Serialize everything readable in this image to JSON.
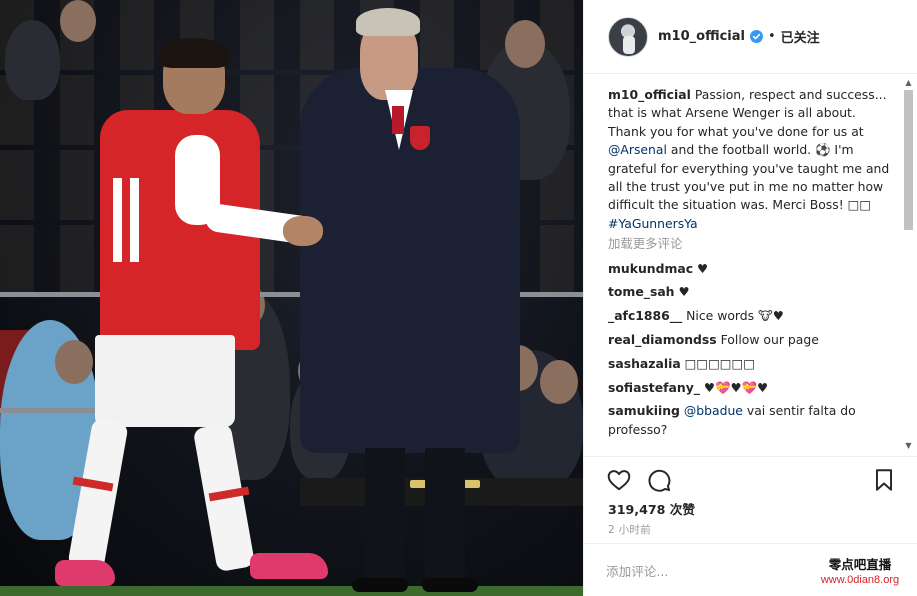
{
  "post": {
    "username": "m10_official",
    "follow_status": "已关注",
    "separator": "•",
    "caption": {
      "username": "m10_official",
      "text_1": " Passion, respect and success... that is what Arsene Wenger is all about. Thank you for what you've done for us at ",
      "mention": "@Arsenal",
      "text_2": " and the football world. ⚽ I'm grateful for everything you've taught me and all the trust you've put in me no matter how difficult the situation was. Merci Boss! ",
      "emoji_boxes": "□□",
      "hashtag": "#YaGunnersYa"
    },
    "load_more": "加载更多评论",
    "comments": [
      {
        "user": "mukundmac",
        "text": " ♥"
      },
      {
        "user": "tome_sah",
        "text": " ♥"
      },
      {
        "user": "_afc1886__",
        "text": " Nice words 🐮♥"
      },
      {
        "user": "real_diamondss",
        "text": " Follow our page"
      },
      {
        "user": "sashazalia",
        "text": " □□□□□□"
      },
      {
        "user": "sofiastefany_",
        "text": " ♥💝♥💝♥"
      },
      {
        "user": "samukiing",
        "mention": "@bbadue",
        "text": " vai sentir falta do professo?"
      }
    ],
    "likes": "319,478 次赞",
    "time": "2 小时前",
    "add_comment_placeholder": "添加评论..."
  },
  "icons": {
    "like": "heart-outline-icon",
    "comment": "speech-bubble-icon",
    "save": "bookmark-icon",
    "verified": "verified-badge-icon"
  },
  "colors": {
    "link": "#003569",
    "muted": "#999999",
    "verified": "#3897f0",
    "text": "#262626",
    "border": "#efefef"
  },
  "watermark": {
    "title": "零点吧直播",
    "url": "www.0dian8.org"
  }
}
